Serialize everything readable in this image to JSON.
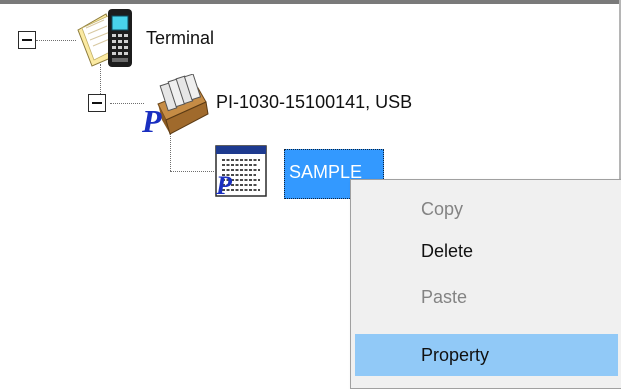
{
  "tree": {
    "root": {
      "label": "Terminal",
      "expanded": true,
      "icon": "handheld-terminal-icon"
    },
    "device": {
      "label": "PI-1030-15100141, USB",
      "expanded": true,
      "icon": "program-box-icon"
    },
    "program": {
      "label": "SAMPLE",
      "selected": true,
      "icon": "program-document-icon"
    }
  },
  "context_menu": {
    "items": [
      {
        "label": "Copy",
        "enabled": false
      },
      {
        "label": "Delete",
        "enabled": true
      },
      {
        "label": "Paste",
        "enabled": false
      },
      {
        "label": "Property",
        "enabled": true,
        "highlighted": true
      }
    ]
  },
  "colors": {
    "selection": "#3399ff",
    "menu_highlight": "#91c9f7",
    "menu_background": "#f0f0f0",
    "disabled_text": "#838383"
  }
}
